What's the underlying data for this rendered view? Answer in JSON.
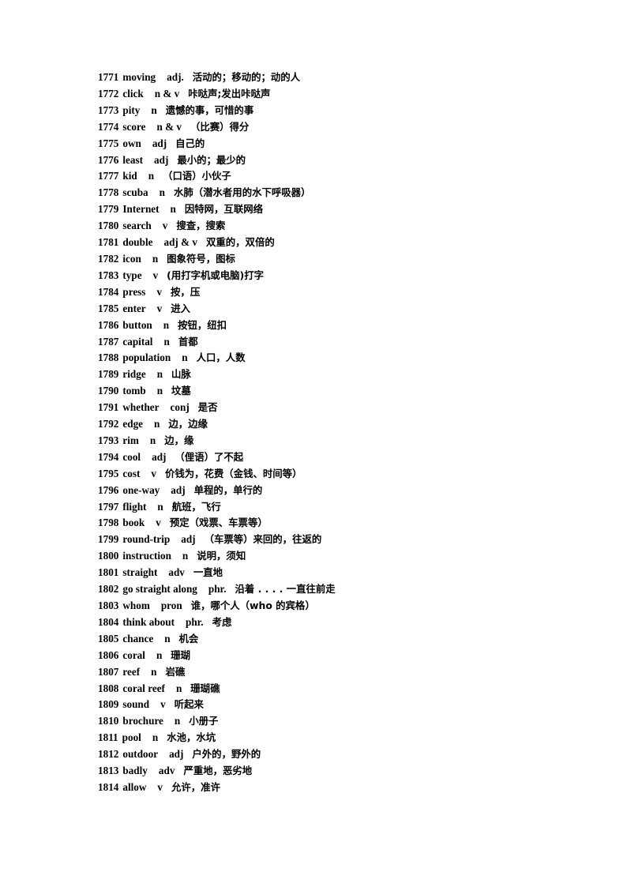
{
  "document": {
    "type": "vocabulary-word-list",
    "background_color": "#ffffff",
    "text_color": "#000000",
    "entries": [
      {
        "num": "1771",
        "term": "moving",
        "pos": "adj.",
        "def": "活动的；移动的；动的人"
      },
      {
        "num": "1772",
        "term": "click",
        "pos": "n & v",
        "def": "咔哒声;发出咔哒声"
      },
      {
        "num": "1773",
        "term": "pity",
        "pos": "n",
        "def": "遗憾的事，可惜的事"
      },
      {
        "num": "1774",
        "term": "score",
        "pos": "n & v",
        "def": "（比赛）得分"
      },
      {
        "num": "1775",
        "term": "own",
        "pos": "adj",
        "def": "自己的"
      },
      {
        "num": "1776",
        "term": "least",
        "pos": "adj",
        "def": "最小的；最少的"
      },
      {
        "num": "1777",
        "term": "kid",
        "pos": "n",
        "def": "（口语）小伙子"
      },
      {
        "num": "1778",
        "term": "scuba",
        "pos": "n",
        "def": "水肺（潜水者用的水下呼吸器）"
      },
      {
        "num": "1779",
        "term": "Internet",
        "pos": "n",
        "def": "因特网，互联网络"
      },
      {
        "num": "1780",
        "term": "search",
        "pos": "v",
        "def": "搜查，搜索"
      },
      {
        "num": "1781",
        "term": "double",
        "pos": "adj & v",
        "def": "双重的，双倍的"
      },
      {
        "num": "1782",
        "term": "icon",
        "pos": "n",
        "def": "图象符号，图标"
      },
      {
        "num": "1783",
        "term": "type",
        "pos": "v",
        "def": "(用打字机或电脑)打字"
      },
      {
        "num": "1784",
        "term": "press",
        "pos": "v",
        "def": "按，压"
      },
      {
        "num": "1785",
        "term": "enter",
        "pos": "v",
        "def": "进入"
      },
      {
        "num": "1786",
        "term": "button",
        "pos": "n",
        "def": "按钮，纽扣"
      },
      {
        "num": "1787",
        "term": "capital",
        "pos": "n",
        "def": "首都"
      },
      {
        "num": "1788",
        "term": "population",
        "pos": "n",
        "def": "人口，人数"
      },
      {
        "num": "1789",
        "term": "ridge",
        "pos": "n",
        "def": "山脉"
      },
      {
        "num": "1790",
        "term": "tomb",
        "pos": "n",
        "def": "坟墓"
      },
      {
        "num": "1791",
        "term": "whether",
        "pos": "conj",
        "def": "是否"
      },
      {
        "num": "1792",
        "term": "edge",
        "pos": "n",
        "def": "边，边缘"
      },
      {
        "num": "1793",
        "term": "rim",
        "pos": "n",
        "def": "边，缘"
      },
      {
        "num": "1794",
        "term": "cool",
        "pos": "adj",
        "def": "（俚语）了不起"
      },
      {
        "num": "1795",
        "term": "cost",
        "pos": "v",
        "def": "价钱为，花费（金钱、时间等）"
      },
      {
        "num": "1796",
        "term": "one-way",
        "pos": "adj",
        "def": "单程的，单行的"
      },
      {
        "num": "1797",
        "term": "flight",
        "pos": "n",
        "def": "航班，飞行"
      },
      {
        "num": "1798",
        "term": "book",
        "pos": "v",
        "def": "预定（戏票、车票等）"
      },
      {
        "num": "1799",
        "term": "round-trip",
        "pos": "adj",
        "def": "（车票等）来回的，往返的"
      },
      {
        "num": "1800",
        "term": "instruction",
        "pos": "n",
        "def": "说明，须知"
      },
      {
        "num": "1801",
        "term": "straight",
        "pos": "adv",
        "def": "一直地"
      },
      {
        "num": "1802",
        "term": "go straight along",
        "pos": "phr.",
        "def": "沿着 . . . . 一直往前走"
      },
      {
        "num": "1803",
        "term": "whom",
        "pos": "pron",
        "def": "谁，哪个人（who 的宾格）"
      },
      {
        "num": "1804",
        "term": "think about",
        "pos": "phr.",
        "def": "考虑"
      },
      {
        "num": "1805",
        "term": "chance",
        "pos": "n",
        "def": "机会"
      },
      {
        "num": "1806",
        "term": "coral",
        "pos": "n",
        "def": "珊瑚"
      },
      {
        "num": "1807",
        "term": "reef",
        "pos": "n",
        "def": "岩礁"
      },
      {
        "num": "1808",
        "term": "coral reef",
        "pos": "n",
        "def": "珊瑚礁"
      },
      {
        "num": "1809",
        "term": "sound",
        "pos": "v",
        "def": "听起来"
      },
      {
        "num": "1810",
        "term": "brochure",
        "pos": "n",
        "def": "小册子"
      },
      {
        "num": "1811",
        "term": "pool",
        "pos": "n",
        "def": "水池，水坑"
      },
      {
        "num": "1812",
        "term": "outdoor",
        "pos": "adj",
        "def": "户外的，野外的"
      },
      {
        "num": "1813",
        "term": "badly",
        "pos": "adv",
        "def": "严重地，恶劣地"
      },
      {
        "num": "1814",
        "term": "allow",
        "pos": "v",
        "def": "允许，准许"
      }
    ]
  }
}
